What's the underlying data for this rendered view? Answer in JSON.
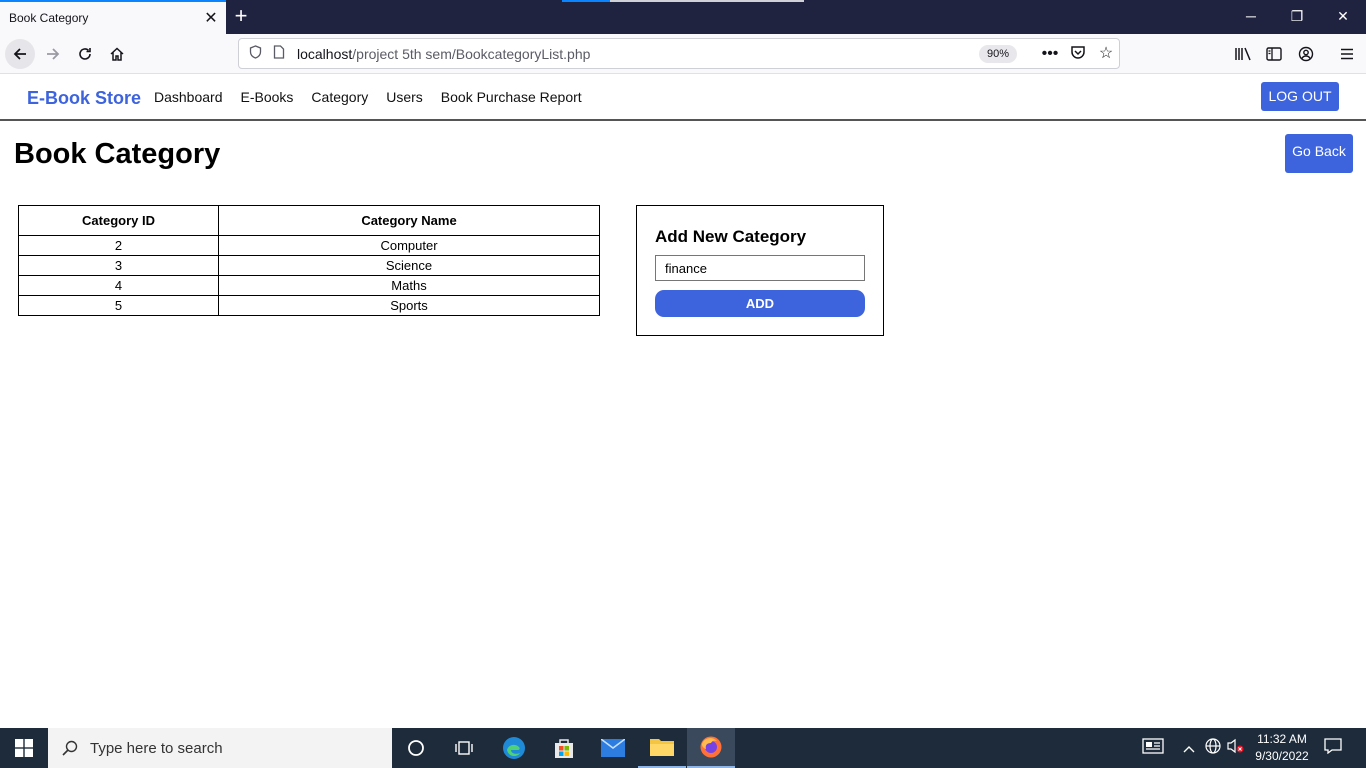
{
  "browser": {
    "tab_title": "Book Category",
    "url_host": "localhost",
    "url_path": "/project 5th sem/BookcategoryList.php",
    "zoom": "90%"
  },
  "site": {
    "brand": "E-Book Store",
    "nav": [
      {
        "label": "Dashboard"
      },
      {
        "label": "E-Books"
      },
      {
        "label": "Category"
      },
      {
        "label": "Users"
      },
      {
        "label": "Book Purchase Report"
      }
    ],
    "logout_label": "LOG OUT"
  },
  "page": {
    "title": "Book Category",
    "go_back_label": "Go Back"
  },
  "table": {
    "headers": [
      "Category ID",
      "Category Name"
    ],
    "rows": [
      {
        "id": "2",
        "name": "Computer"
      },
      {
        "id": "3",
        "name": "Science"
      },
      {
        "id": "4",
        "name": "Maths"
      },
      {
        "id": "5",
        "name": "Sports"
      }
    ]
  },
  "add_form": {
    "title": "Add New Category",
    "input_value": "finance",
    "button_label": "ADD"
  },
  "taskbar": {
    "search_placeholder": "Type here to search",
    "time": "11:32 AM",
    "date": "9/30/2022"
  },
  "colors": {
    "accent": "#3d63dd",
    "tabbar": "#202340",
    "taskbar": "#1d2b3a"
  }
}
